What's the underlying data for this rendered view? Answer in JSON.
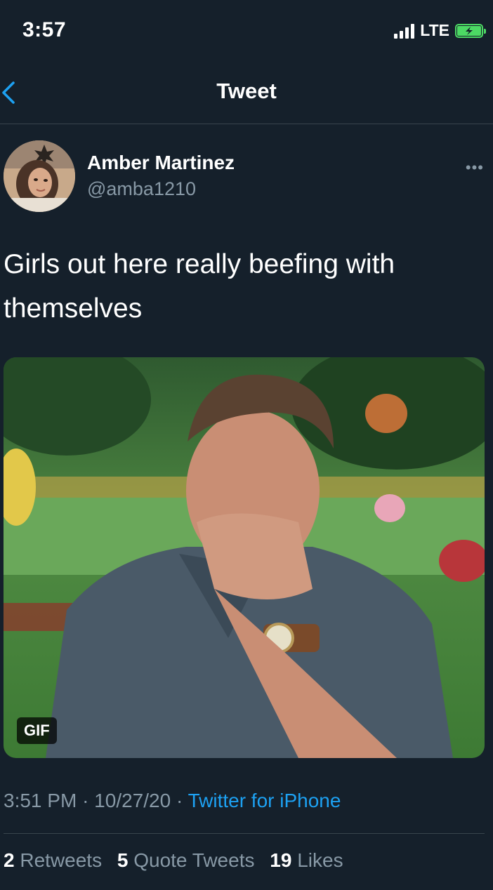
{
  "status_bar": {
    "time": "3:57",
    "network": "LTE",
    "signal_icon": "signal-bars-icon",
    "battery_icon": "battery-charging-icon"
  },
  "nav": {
    "title": "Tweet",
    "back_icon": "chevron-left-icon"
  },
  "tweet": {
    "author_name": "Amber Martinez",
    "handle": "@amba1210",
    "more_label": "•••",
    "text": "Girls out here really beefing with themselves",
    "media": {
      "gif_label": "GIF"
    },
    "time": "3:51 PM",
    "date": "10/27/20",
    "separator": "·",
    "source": "Twitter for iPhone"
  },
  "stats": {
    "retweets_count": "2",
    "retweets_label": "Retweets",
    "quotes_count": "5",
    "quotes_label": "Quote Tweets",
    "likes_count": "19",
    "likes_label": "Likes"
  },
  "colors": {
    "background": "#15202b",
    "accent": "#1da1f2",
    "secondary_text": "#8899a6",
    "divider": "#38444d"
  }
}
